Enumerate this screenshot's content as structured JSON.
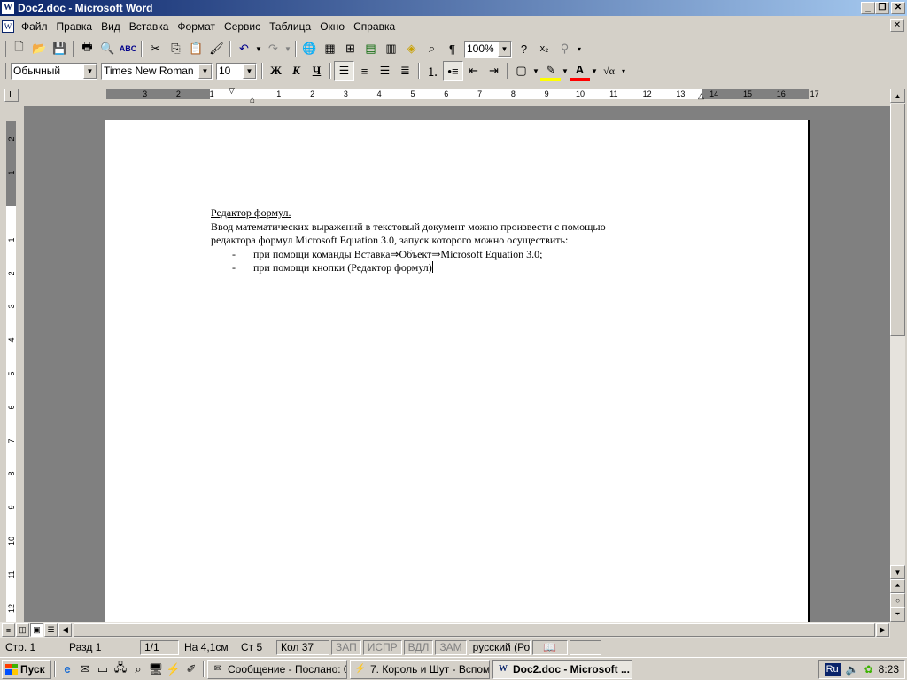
{
  "window": {
    "title": "Doc2.doc - Microsoft Word",
    "controls": [
      "minimize",
      "maximize",
      "close"
    ]
  },
  "menu": [
    "Файл",
    "Правка",
    "Вид",
    "Вставка",
    "Формат",
    "Сервис",
    "Таблица",
    "Окно",
    "Справка"
  ],
  "toolbar_standard": {
    "zoom": "100%",
    "icons": [
      "new-icon",
      "open-icon",
      "save-icon",
      "print-icon",
      "print-preview-icon",
      "spelling-icon",
      "cut-icon",
      "copy-icon",
      "paste-icon",
      "format-painter-icon",
      "undo-icon",
      "redo-icon",
      "hyperlink-icon",
      "tables-borders-icon",
      "insert-table-icon",
      "insert-excel-icon",
      "columns-icon",
      "drawing-icon",
      "document-map-icon",
      "show-hide-icon",
      "help-icon",
      "subscript-icon",
      "tree-icon"
    ]
  },
  "toolbar_formatting": {
    "style": "Обычный",
    "font": "Times New Roman",
    "size": "10",
    "bold": "Ж",
    "italic": "К",
    "underline": "Ч"
  },
  "ruler": {
    "left_labels": [
      "3",
      "2",
      "1"
    ],
    "right_labels": [
      "1",
      "2",
      "3",
      "4",
      "5",
      "6",
      "7",
      "8",
      "9",
      "10",
      "11",
      "12",
      "13",
      "14",
      "15",
      "16",
      "17"
    ],
    "vertical_labels": [
      "2",
      "1",
      "1",
      "2",
      "3",
      "4",
      "5",
      "6",
      "7",
      "8",
      "9",
      "10",
      "11",
      "12"
    ]
  },
  "document": {
    "heading": "Редактор формул.",
    "paragraph_line1": "Ввод математических выражений в текстовый документ можно произвести с помощью",
    "paragraph_line2": "редактора формул Microsoft Equation 3.0, запуск которого можно осуществить:",
    "bullets": [
      {
        "dash": "-",
        "text": "при помощи команды Вставка⇒Объект⇒Microsoft Equation 3.0;"
      },
      {
        "dash": "-",
        "text": "при помощи кнопки (Редактор формул)"
      }
    ]
  },
  "statusbar": {
    "page": "Стр. 1",
    "section": "Разд 1",
    "pages": "1/1",
    "at": "На 4,1см",
    "line": "Ст 5",
    "col": "Кол 37",
    "rec": "ЗАП",
    "trk": "ИСПР",
    "ext": "ВДЛ",
    "ovr": "ЗАМ",
    "language": "русский (Ро"
  },
  "taskbar": {
    "start": "Пуск",
    "tasks": [
      {
        "label": "Сообщение - Послано: 0...",
        "icon": "message-icon",
        "active": false
      },
      {
        "label": "7. Король и Шут - Вспом...",
        "icon": "winamp-icon",
        "active": false
      },
      {
        "label": "Doc2.doc - Microsoft ...",
        "icon": "word-icon",
        "active": true
      }
    ],
    "lang": "Ru",
    "clock": "8:23"
  },
  "colors": {
    "title_start": "#0a246a",
    "title_end": "#a6caf0",
    "face": "#d4d0c8",
    "workspace": "#808080"
  }
}
